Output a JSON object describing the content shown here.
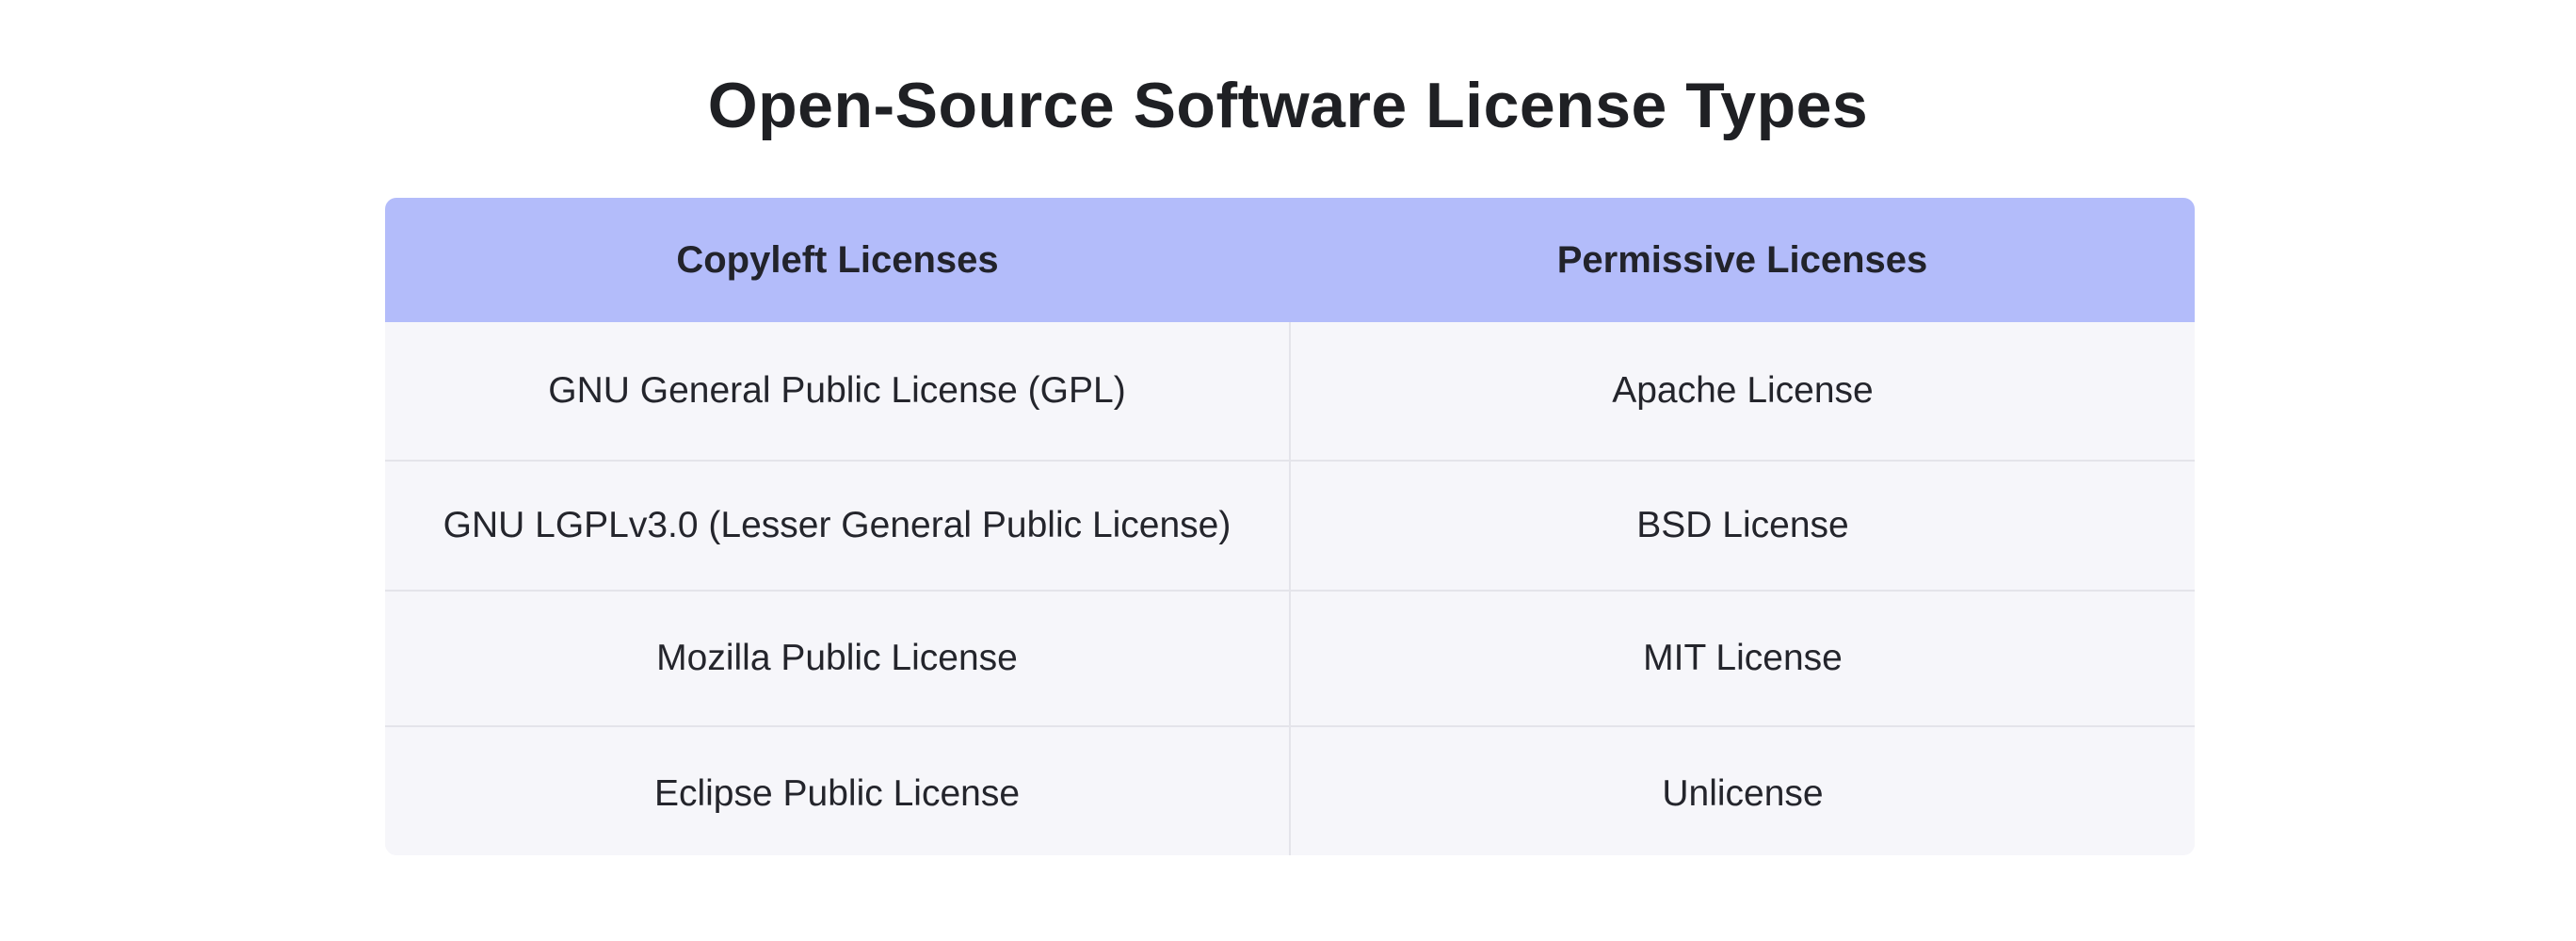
{
  "title": "Open-Source Software License Types",
  "table": {
    "headers": [
      "Copyleft Licenses",
      "Permissive Licenses"
    ],
    "rows": [
      [
        "GNU General Public License (GPL)",
        "Apache License"
      ],
      [
        "GNU LGPLv3.0 (Lesser General Public License)",
        "BSD License"
      ],
      [
        "Mozilla Public License",
        "MIT License"
      ],
      [
        "Eclipse Public License",
        "Unlicense"
      ]
    ]
  },
  "colors": {
    "header_background": "#b3bcfa",
    "body_background": "#f6f6fa",
    "divider": "#e4e4ea",
    "text": "#22232b"
  }
}
